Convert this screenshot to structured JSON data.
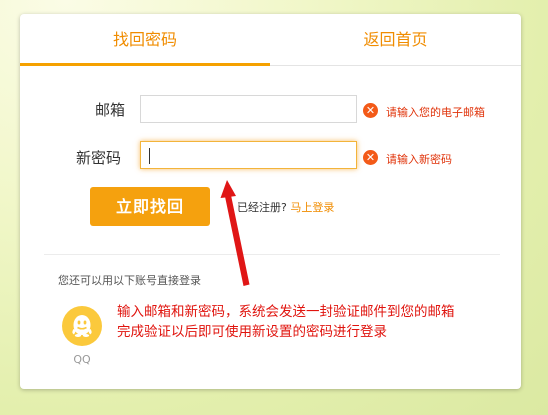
{
  "tabs": {
    "find_password": "找回密码",
    "back_home": "返回首页"
  },
  "form": {
    "email_label": "邮箱",
    "email_value": "",
    "email_error": "请输入您的电子邮箱",
    "password_label": "新密码",
    "password_value": "",
    "password_error": "请输入新密码",
    "submit_label": "立即找回",
    "registered_text": "已经注册?",
    "login_link": "马上登录"
  },
  "third_party": {
    "prompt": "您还可以用以下账号直接登录",
    "qq_label": "QQ"
  },
  "annotation": {
    "line1": "输入邮箱和新密码，系统会发送一封验证邮件到您的邮箱",
    "line2": "完成验证以后即可使用新设置的密码进行登录"
  },
  "colors": {
    "accent": "#f5a10e",
    "error": "#e0330a",
    "annotation": "#e0140e"
  },
  "icons": {
    "error": "close-circle-icon",
    "qq": "qq-penguin-icon"
  }
}
